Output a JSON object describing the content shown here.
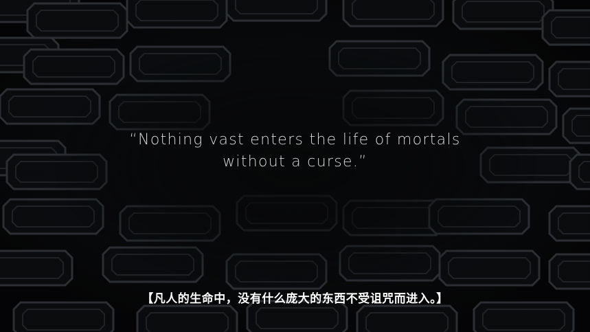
{
  "cutscene": {
    "quote_line_1": "“Nothing vast enters the life of mortals",
    "quote_line_2": "without a curse.”",
    "subtitle": "【凡人的生命中，没有什么庞大的东西不受诅咒而进入。】"
  },
  "colors": {
    "background": "#060708",
    "panel_stroke": "#3a3d41",
    "quote_text": "#d6d8da",
    "subtitle_text": "#ffffff"
  }
}
